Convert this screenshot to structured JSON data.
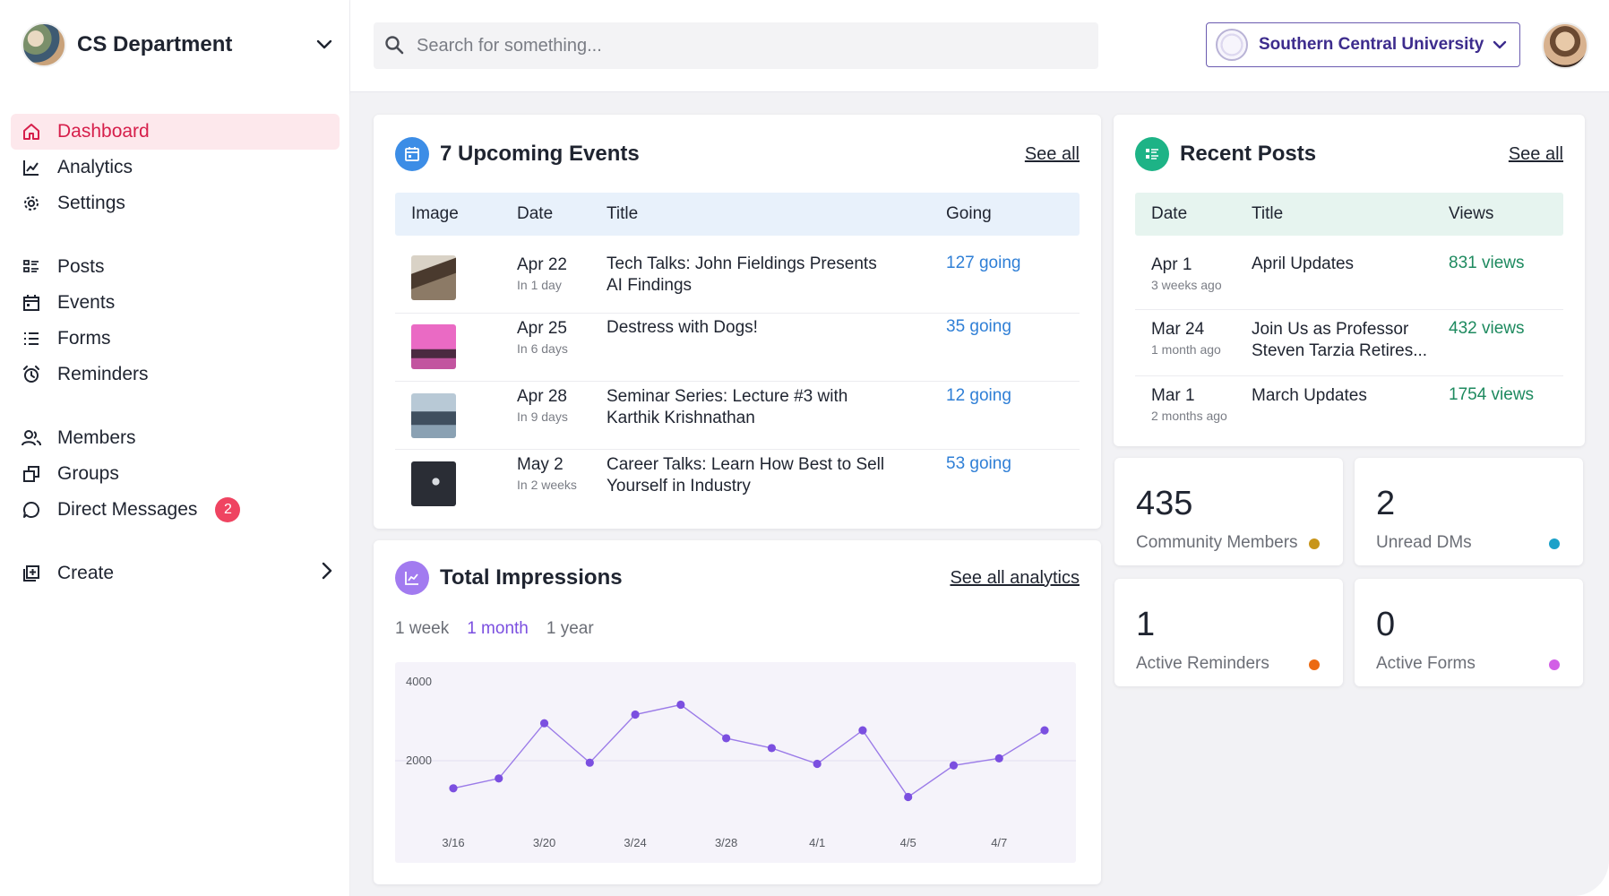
{
  "org": {
    "name": "CS Department"
  },
  "nav": {
    "dashboard": "Dashboard",
    "analytics": "Analytics",
    "settings": "Settings",
    "posts": "Posts",
    "events": "Events",
    "forms": "Forms",
    "reminders": "Reminders",
    "members": "Members",
    "groups": "Groups",
    "direct_messages": "Direct Messages",
    "direct_messages_badge": "2",
    "create": "Create"
  },
  "search": {
    "placeholder": "Search for something..."
  },
  "university": {
    "name": "Southern Central University"
  },
  "events": {
    "title": "7 Upcoming Events",
    "see_all": "See all",
    "columns": [
      "Image",
      "Date",
      "Title",
      "Going"
    ],
    "rows": [
      {
        "date": "Apr 22",
        "relative": "In 1 day",
        "title": "Tech Talks: John Fieldings Presents AI Findings",
        "going": "127 going",
        "thumb_color": "#7a6a58"
      },
      {
        "date": "Apr 25",
        "relative": "In 6 days",
        "title": "Destress with Dogs!",
        "going": "35 going",
        "thumb_color": "#e86bc3"
      },
      {
        "date": "Apr 28",
        "relative": "In 9 days",
        "title": "Seminar Series: Lecture #3 with Karthik Krishnathan",
        "going": "12 going",
        "thumb_color": "#6f8799"
      },
      {
        "date": "May 2",
        "relative": "In 2 weeks",
        "title": "Career Talks: Learn How Best to Sell Yourself in Industry",
        "going": "53 going",
        "thumb_color": "#1f2229"
      }
    ]
  },
  "posts": {
    "title": "Recent Posts",
    "see_all": "See all",
    "columns": [
      "Date",
      "Title",
      "Views"
    ],
    "rows": [
      {
        "date": "Apr 1",
        "relative": "3 weeks ago",
        "title": "April Updates",
        "views": "831 views"
      },
      {
        "date": "Mar 24",
        "relative": "1 month ago",
        "title": "Join Us as Professor Steven Tarzia Retires...",
        "views": "432 views"
      },
      {
        "date": "Mar 1",
        "relative": "2 months ago",
        "title": "March Updates",
        "views": "1754 views"
      }
    ]
  },
  "stats": [
    {
      "value": "435",
      "label": "Community Members",
      "color": "#c8951a"
    },
    {
      "value": "2",
      "label": "Unread DMs",
      "color": "#1ba1c9"
    },
    {
      "value": "1",
      "label": "Active Reminders",
      "color": "#ec6a12"
    },
    {
      "value": "0",
      "label": "Active Forms",
      "color": "#d25fe6"
    }
  ],
  "impressions": {
    "title": "Total Impressions",
    "see_all": "See all analytics",
    "ranges": [
      "1 week",
      "1 month",
      "1 year"
    ],
    "active_range": "1 month"
  },
  "colors": {
    "accent_red": "#d61f4b",
    "link_blue": "#2f7fd6",
    "views_green": "#1e8a5f",
    "chart_purple": "#7b4fe0",
    "university_purple": "#3d2c8d"
  },
  "chart_data": {
    "type": "line",
    "x": [
      "3/16",
      "3/18",
      "3/20",
      "3/22",
      "3/24",
      "3/26",
      "3/28",
      "3/30",
      "4/1",
      "4/3",
      "4/5",
      "4/6",
      "4/7",
      "4/8"
    ],
    "tick_labels": [
      "3/16",
      "3/20",
      "3/24",
      "3/28",
      "4/1",
      "4/5",
      "4/7"
    ],
    "values": [
      1300,
      1550,
      2950,
      1950,
      3170,
      3420,
      2570,
      2320,
      1920,
      2770,
      1080,
      1880,
      2060,
      2770
    ],
    "ylim": [
      0,
      4000
    ],
    "yticks": [
      2000,
      4000
    ],
    "grid": true
  }
}
